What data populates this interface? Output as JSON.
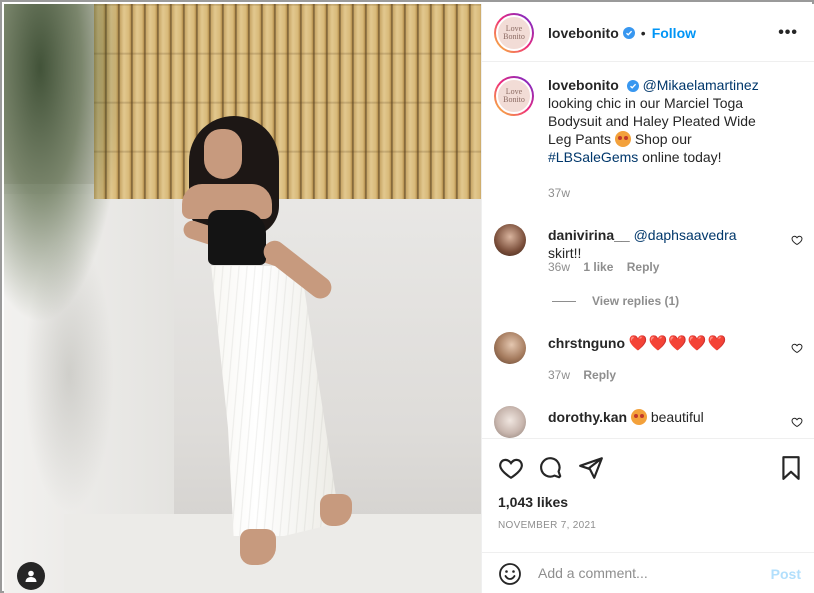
{
  "post": {
    "account": "lovebonito",
    "avatar_text": "Love Bonito",
    "follow_label": "Follow",
    "more_label": "•••",
    "dot": "•",
    "likes": "1,043 likes",
    "date": "NOVEMBER 7, 2021",
    "add_comment_placeholder": "Add a comment...",
    "post_label": "Post"
  },
  "caption": {
    "username": "lovebonito",
    "mention": "@Mikaelamartinez",
    "text_1": "looking chic in our Marciel Toga Bodysuit and Haley Pleated Wide Leg Pants",
    "text_2": "Shop our",
    "hashtag": "#LBSaleGems",
    "text_3": "online today!",
    "time": "37w"
  },
  "comments": [
    {
      "username": "danivirina__",
      "mention": "@daphsaavedra",
      "text": "skirt!!",
      "time": "36w",
      "likes": "1 like",
      "reply": "Reply",
      "view_replies": "View replies (1)"
    },
    {
      "username": "chrstnguno",
      "text": "❤️❤️❤️❤️❤️",
      "time": "37w",
      "reply": "Reply"
    },
    {
      "username": "dorothy.kan",
      "text": "beautiful"
    }
  ],
  "colors": {
    "accent_blue": "#0095f6",
    "mention_blue": "#00376b",
    "muted": "#8e8e8e"
  },
  "icons": [
    "user-tag-icon",
    "verified-badge-icon",
    "heart-icon",
    "comment-icon",
    "share-icon",
    "bookmark-icon",
    "emoji-icon",
    "more-options-icon"
  ]
}
